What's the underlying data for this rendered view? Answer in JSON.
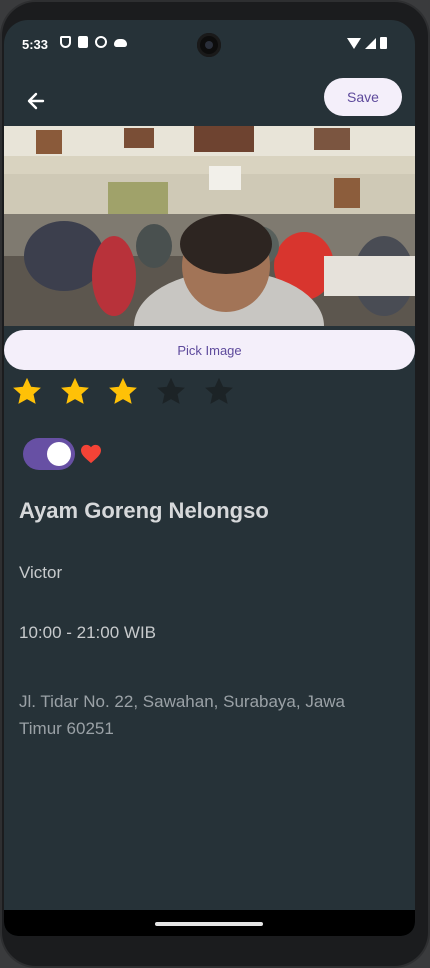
{
  "status_bar": {
    "time": "5:33",
    "left_icons": [
      "shield-icon",
      "sim-card-icon",
      "bag-icon",
      "cloud-icon"
    ],
    "right_icons": [
      "wifi-icon",
      "signal-icon",
      "battery-icon"
    ]
  },
  "app_bar": {
    "back_icon": "arrow-left-icon",
    "save_label": "Save"
  },
  "image": {
    "alt": "restaurant-dining-room-photo"
  },
  "pick_image_label": "Pick Image",
  "rating": {
    "value": 3,
    "max": 5,
    "filled_color": "#FFC107",
    "empty_color": "#1c2326"
  },
  "favorite": {
    "toggle_on": true,
    "toggle_color": "#6750A4",
    "heart_color": "#F44336"
  },
  "restaurant": {
    "name": "Ayam Goreng Nelongso",
    "owner": "Victor",
    "hours": "10:00 - 21:00 WIB",
    "address": "Jl. Tidar No. 22, Sawahan, Surabaya, Jawa Timur 60251"
  },
  "colors": {
    "background": "#263238",
    "accent": "#6750A4",
    "button_bg": "#F4EFFA"
  }
}
